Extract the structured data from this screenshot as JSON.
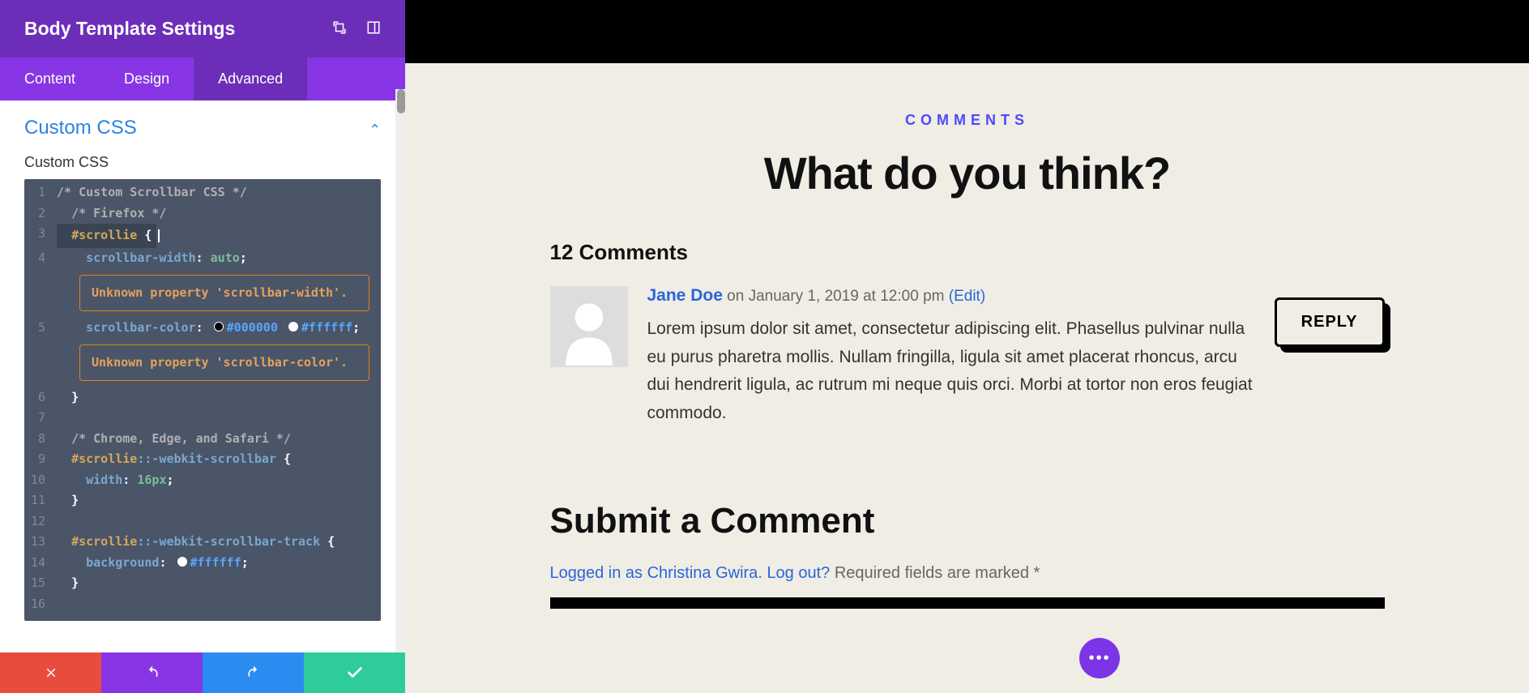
{
  "panel": {
    "title": "Body Template Settings",
    "tabs": [
      "Content",
      "Design",
      "Advanced"
    ],
    "active_tab": 2,
    "accordion_title": "Custom CSS",
    "field_label": "Custom CSS",
    "code": {
      "l1": "/* Custom Scrollbar CSS */",
      "l2": "/* Firefox */",
      "l3_sel": "#scrollie",
      "l3_brace": "{",
      "l4_prop": "scrollbar-width",
      "l4_val": "auto",
      "warn1": "Unknown property 'scrollbar-width'.",
      "l5_prop": "scrollbar-color",
      "l5_hex1": "#000000",
      "l5_hex2": "#ffffff",
      "warn2": "Unknown property 'scrollbar-color'.",
      "l6": "}",
      "l8": "/* Chrome, Edge, and Safari */",
      "l9_sel": "#scrollie",
      "l9_pseudo": "::-webkit-scrollbar",
      "l9_brace": " {",
      "l10_prop": "width",
      "l10_val": "16px",
      "l11": "}",
      "l13_sel": "#scrollie",
      "l13_pseudo": "::-webkit-scrollbar-track",
      "l13_brace": " {",
      "l14_prop": "background",
      "l14_hex": "#ffffff",
      "l15": "}"
    }
  },
  "preview": {
    "overline": "COMMENTS",
    "headline": "What do you think?",
    "count_label": "12 Comments",
    "comment": {
      "author": "Jane Doe",
      "meta": "on January 1, 2019 at 12:00 pm",
      "edit": "(Edit)",
      "body": "Lorem ipsum dolor sit amet, consectetur adipiscing elit. Phasellus pulvinar nulla eu purus pharetra mollis. Nullam fringilla, ligula sit amet placerat rhoncus, arcu dui hendrerit ligula, ac rutrum mi neque quis orci. Morbi at tortor non eros feugiat commodo.",
      "reply": "REPLY"
    },
    "submit_title": "Submit a Comment",
    "logged_prefix": "Logged in as ",
    "logged_user": "Christina Gwira",
    "logout": "Log out?",
    "required": " Required fields are marked *"
  }
}
